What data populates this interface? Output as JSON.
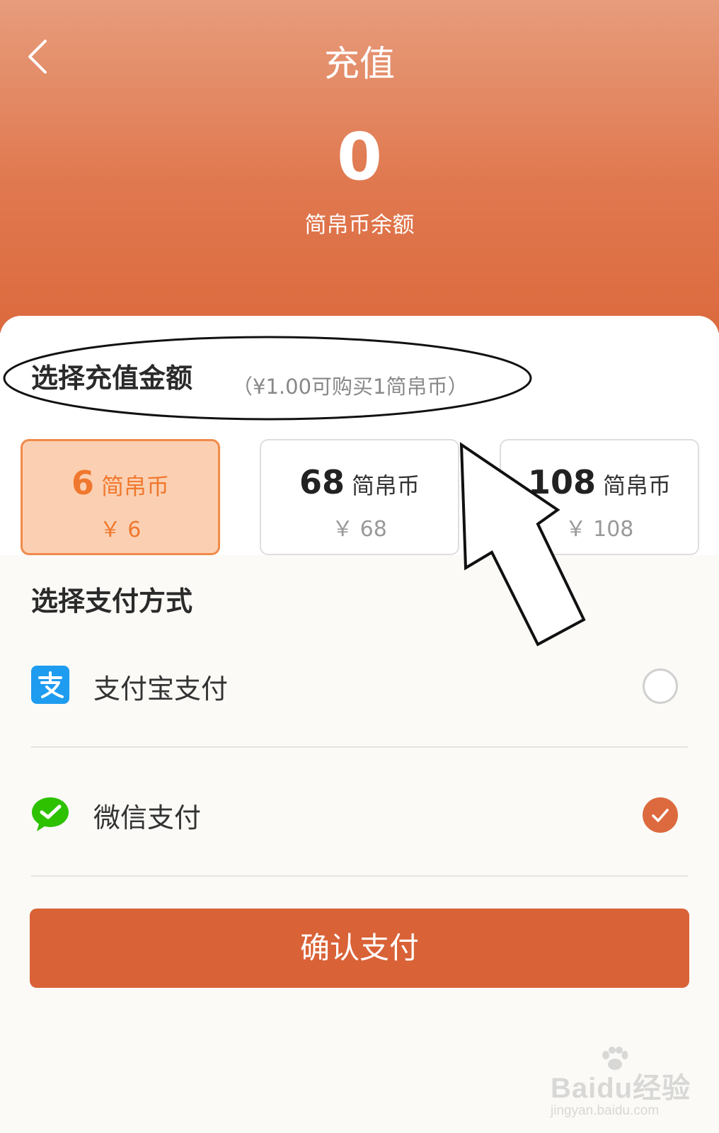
{
  "header": {
    "title": "充值",
    "balance_value": "0",
    "balance_label": "简帛币余额"
  },
  "amount_section": {
    "title": "选择充值金额",
    "hint": "（¥1.00可购买1简帛币）",
    "options": [
      {
        "amount": "6",
        "unit": "简帛币",
        "price": "￥ 6",
        "selected": true
      },
      {
        "amount": "68",
        "unit": "简帛币",
        "price": "￥ 68",
        "selected": false
      },
      {
        "amount": "108",
        "unit": "简帛币",
        "price": "￥ 108",
        "selected": false
      }
    ]
  },
  "payment_section": {
    "title": "选择支付方式",
    "methods": [
      {
        "label": "支付宝支付",
        "icon": "alipay-icon",
        "checked": false
      },
      {
        "label": "微信支付",
        "icon": "wechat-pay-icon",
        "checked": true
      }
    ]
  },
  "confirm_label": "确认支付",
  "watermark": {
    "brand": "Baidu经验",
    "url": "jingyan.baidu.com"
  },
  "colors": {
    "accent": "#dc6a3e",
    "selected_card_bg": "#fbd0b2",
    "selected_card_text": "#f0782e",
    "alipay_blue": "#1e9cf0",
    "wechat_green": "#2dc100"
  }
}
